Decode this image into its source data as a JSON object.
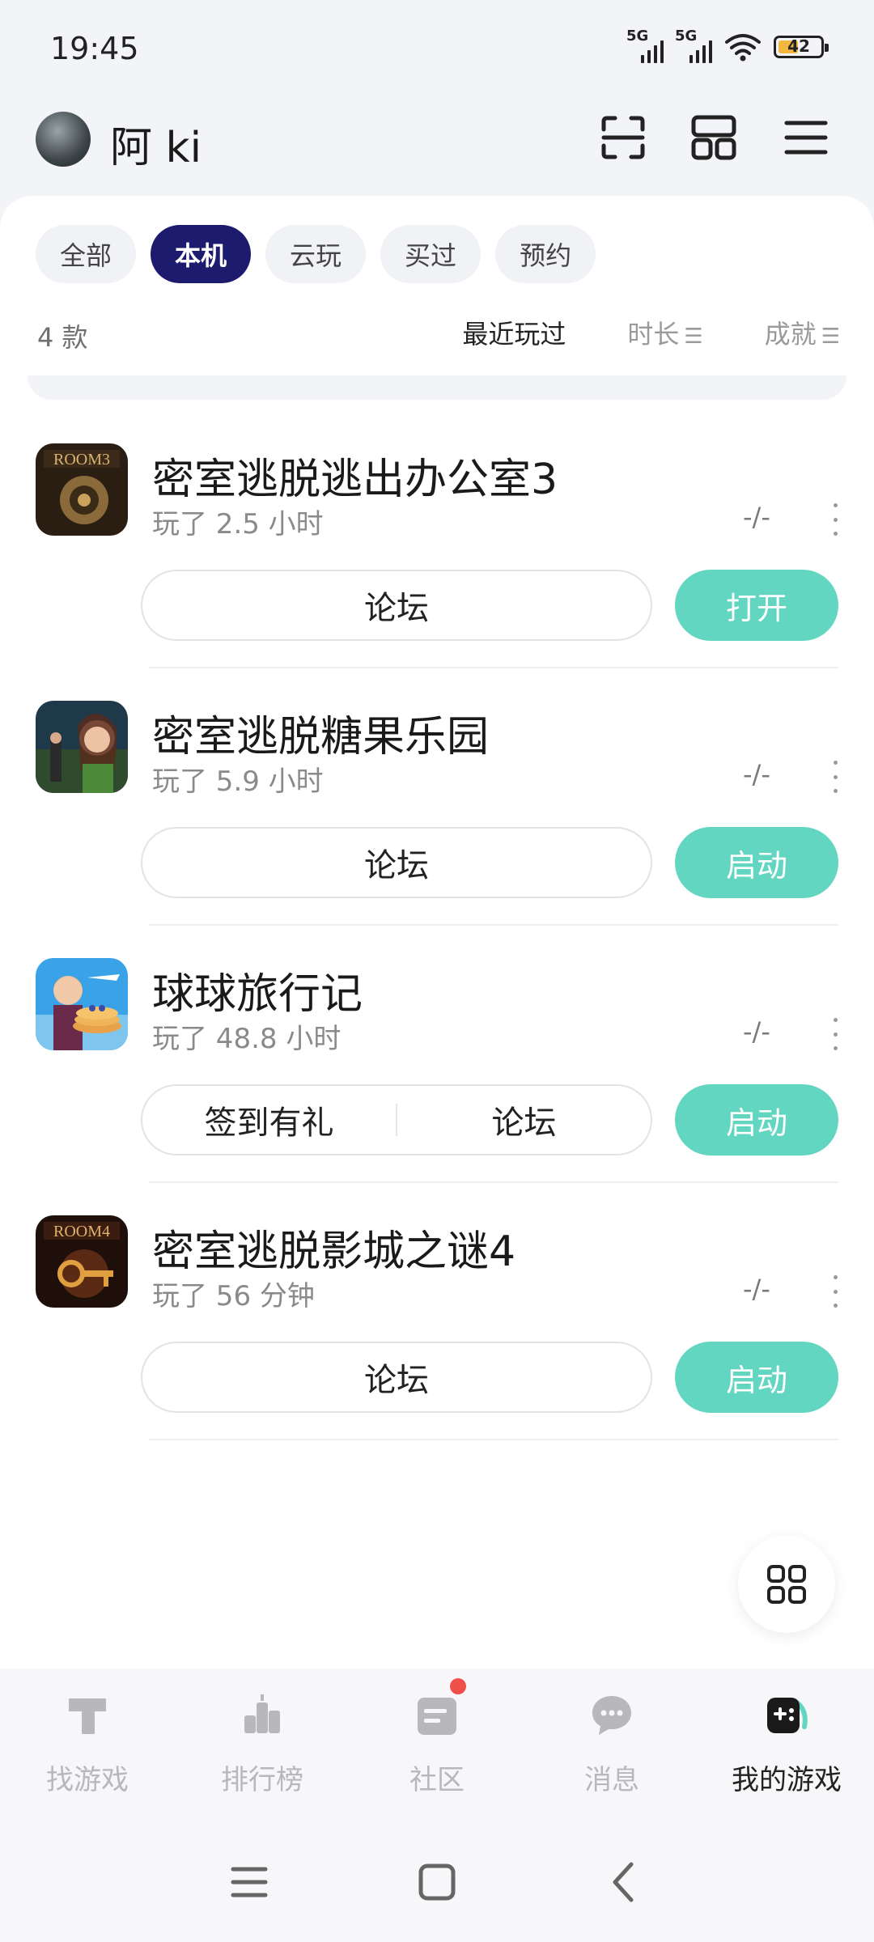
{
  "status_bar": {
    "time": "19:45",
    "signal1": "5G",
    "signal2": "5G",
    "battery": "42"
  },
  "header": {
    "username": "阿 ki"
  },
  "filters": {
    "chips": [
      "全部",
      "本机",
      "云玩",
      "买过",
      "预约"
    ],
    "active_index": 1,
    "count_text": "4 款",
    "sort_recent": "最近玩过",
    "sort_duration": "时长",
    "sort_achievement": "成就"
  },
  "games": [
    {
      "title": "密室逃脱逃出办公室3",
      "played": "玩了 2.5 小时",
      "score": "-/-",
      "links": [
        "论坛"
      ],
      "action": "打开"
    },
    {
      "title": "密室逃脱糖果乐园",
      "played": "玩了 5.9 小时",
      "score": "-/-",
      "links": [
        "论坛"
      ],
      "action": "启动"
    },
    {
      "title": "球球旅行记",
      "played": "玩了 48.8 小时",
      "score": "-/-",
      "links": [
        "签到有礼",
        "论坛"
      ],
      "action": "启动"
    },
    {
      "title": "密室逃脱影城之谜4",
      "played": "玩了 56 分钟",
      "score": "-/-",
      "links": [
        "论坛"
      ],
      "action": "启动"
    }
  ],
  "bottom_nav": {
    "items": [
      "找游戏",
      "排行榜",
      "社区",
      "消息",
      "我的游戏"
    ],
    "active_index": 4
  },
  "colors": {
    "accent": "#62d6c1",
    "active_chip": "#1d1b6e",
    "badge": "#f0504a"
  },
  "icons": {
    "header": [
      "scan-icon",
      "layout-icon",
      "menu-icon"
    ],
    "nav": [
      "find-game-icon",
      "ranking-icon",
      "community-icon",
      "message-icon",
      "my-games-icon"
    ]
  }
}
